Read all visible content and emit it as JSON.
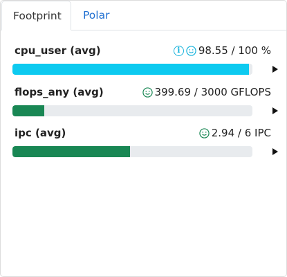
{
  "tabs": [
    {
      "label": "Footprint",
      "active": true
    },
    {
      "label": "Polar",
      "active": false
    }
  ],
  "metrics": [
    {
      "name": "cpu_user (avg)",
      "value": "98.55 / 100 %",
      "fraction": 0.9855,
      "color": "#0dcaf0",
      "icons": [
        "info-icon",
        "smile-icon"
      ],
      "icon_color": "#17b3dc"
    },
    {
      "name": "flops_any (avg)",
      "value": "399.69 / 3000 GFLOPS",
      "fraction": 0.1332,
      "color": "#198754",
      "icons": [
        "smile-icon"
      ],
      "icon_color": "#198754"
    },
    {
      "name": "ipc (avg)",
      "value": "2.94 / 6 IPC",
      "fraction": 0.49,
      "color": "#198754",
      "icons": [
        "smile-icon"
      ],
      "icon_color": "#198754"
    }
  ]
}
